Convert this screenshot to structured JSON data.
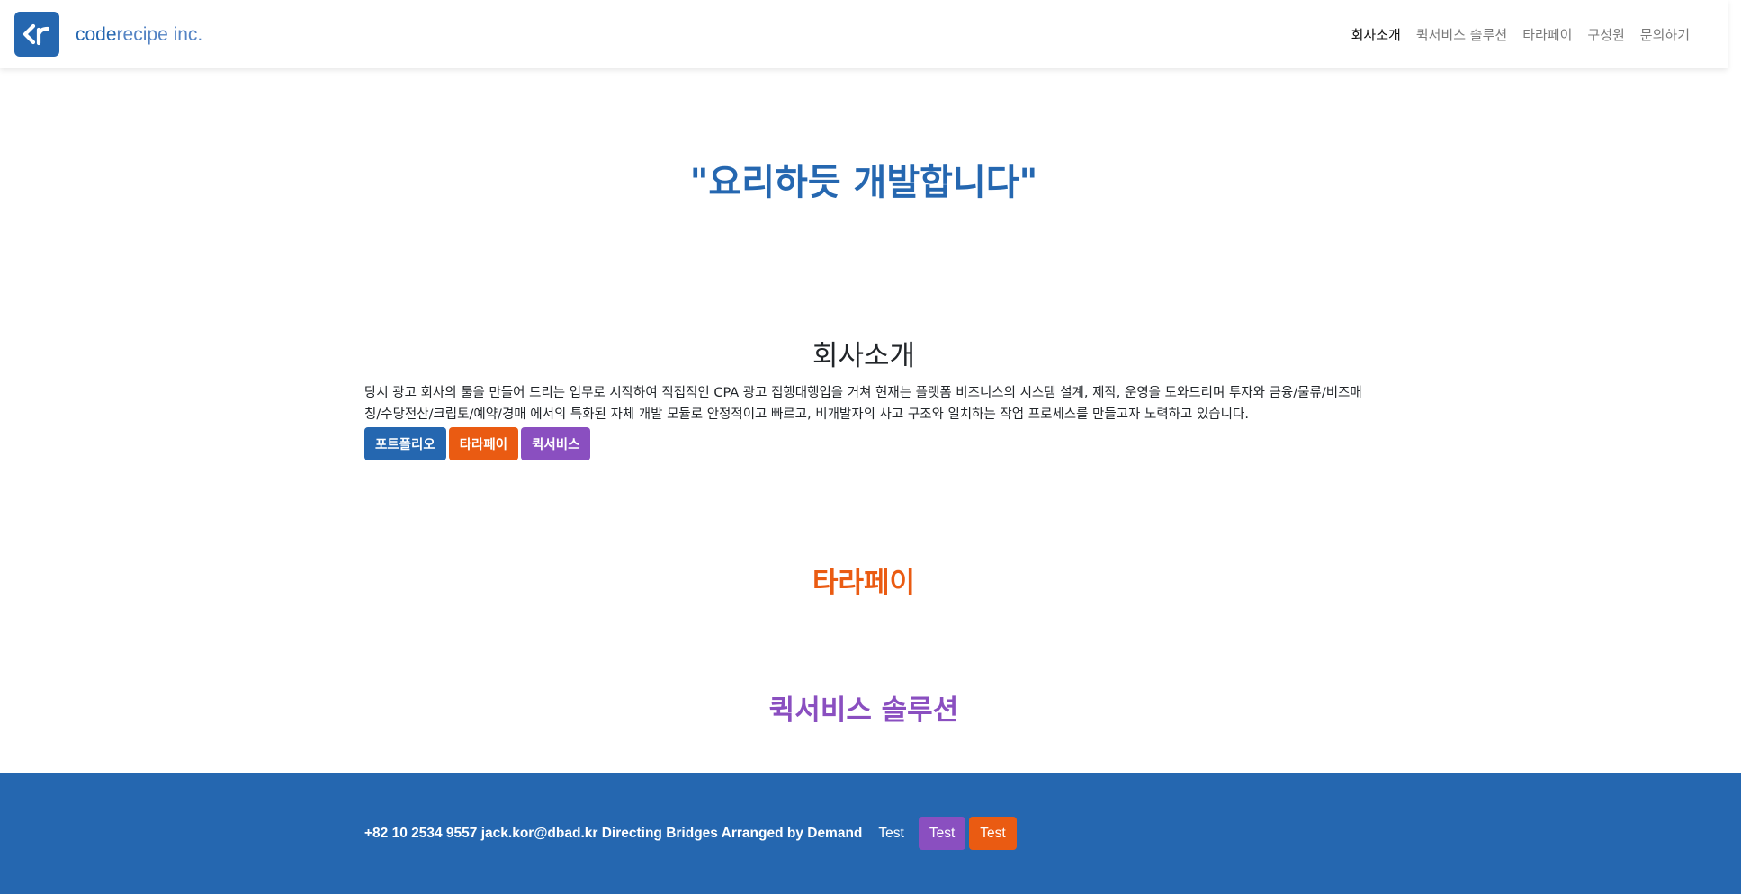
{
  "brand": {
    "name_bold": "code",
    "name_light": "recipe inc.",
    "logo_icon": "code-recipe-logo",
    "color": "#2567b0"
  },
  "nav": {
    "items": [
      {
        "label": "회사소개",
        "active": true
      },
      {
        "label": "퀵서비스 솔루션",
        "active": false
      },
      {
        "label": "타라페이",
        "active": false
      },
      {
        "label": "구성원",
        "active": false
      },
      {
        "label": "문의하기",
        "active": false
      }
    ]
  },
  "hero": {
    "title": "\"요리하듯 개발합니다\""
  },
  "about": {
    "heading": "회사소개",
    "text": "당시 광고 회사의 툴을 만들어 드리는 업무로 시작하여 직접적인 CPA 광고 집행대행업을 거쳐 현재는 플랫폼 비즈니스의 시스템 설계, 제작, 운영을 도와드리며 투자와 금융/물류/비즈매칭/수당전산/크립토/예약/경매 에서의 특화된 자체 개발 모듈로 안정적이고 빠르고, 비개발자의 사고 구조와 일치하는 작업 프로세스를 만들고자 노력하고 있습니다.",
    "buttons": [
      {
        "label": "포트폴리오",
        "color": "#2567b0"
      },
      {
        "label": "타라페이",
        "color": "#ea5b12"
      },
      {
        "label": "퀵서비스",
        "color": "#8a4fc0"
      }
    ]
  },
  "sections": {
    "tarapay_title": "타라페이",
    "tarapay_color": "#ea5b12",
    "quick_title": "퀵서비스 솔루션",
    "quick_color": "#8a4fc0"
  },
  "footer": {
    "info": "+82 10 2534 9557 jack.kor@dbad.kr Directing Bridges Arranged by Demand",
    "link_label": "Test",
    "buttons": [
      {
        "label": "Test",
        "color": "#8a4fc0"
      },
      {
        "label": "Test",
        "color": "#ea5b12"
      }
    ],
    "background": "#2567b0"
  }
}
